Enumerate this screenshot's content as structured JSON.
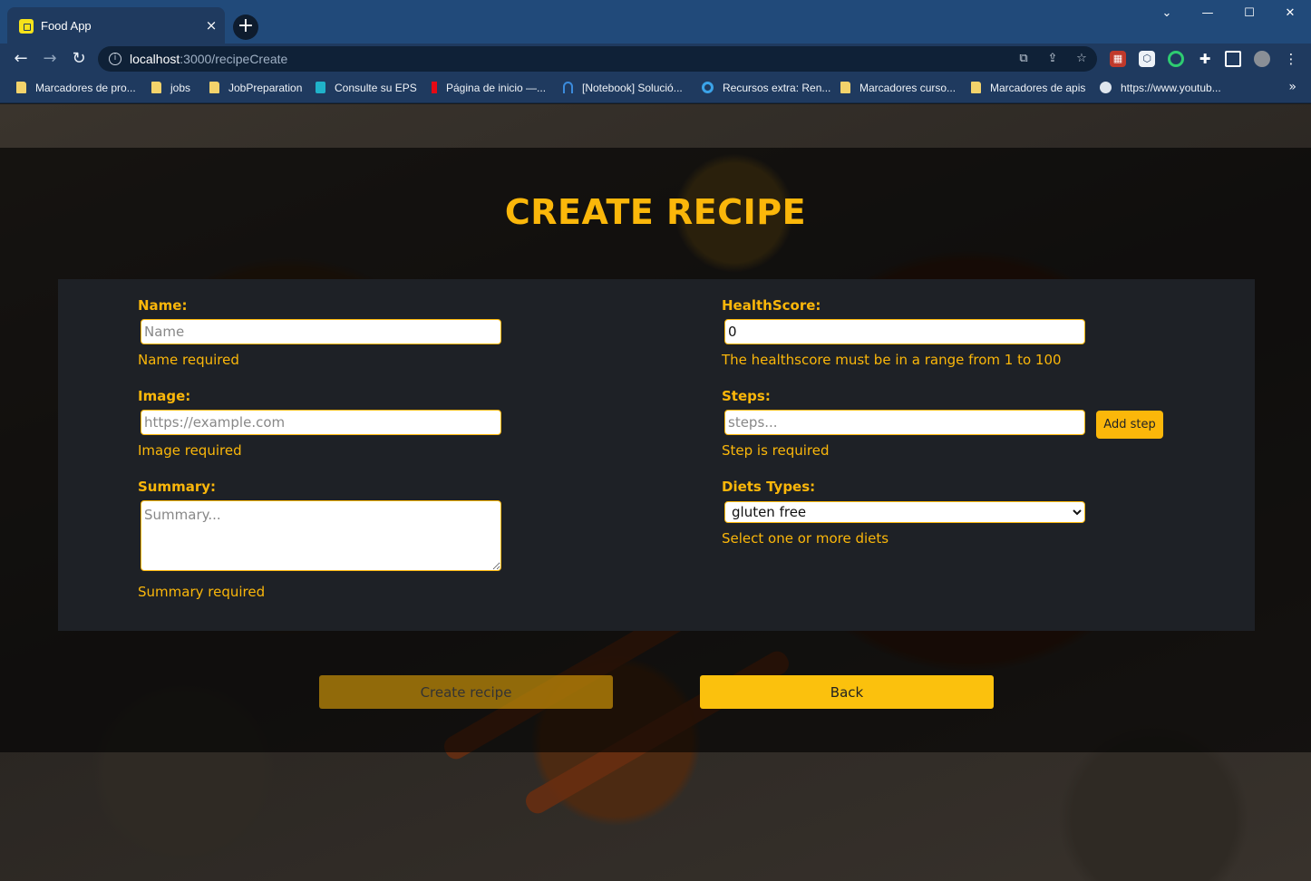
{
  "browser": {
    "tab_title": "Food App",
    "tab_close": "×",
    "new_tab": "+",
    "window_controls": [
      "⌄",
      "—",
      "☐",
      "✕"
    ],
    "url_host": "localhost",
    "url_path": ":3000/recipeCreate",
    "bookmarks": [
      "Marcadores de pro...",
      "jobs",
      "JobPreparation",
      "Consulte su EPS",
      "Página de inicio —...",
      "[Notebook] Solució...",
      "Recursos extra: Ren...",
      "Marcadores curso...",
      "Marcadores de apis",
      "https://www.youtub..."
    ],
    "bookmarks_more": "»"
  },
  "page": {
    "title": "CREATE RECIPE",
    "name": {
      "label": "Name:",
      "placeholder": "Name",
      "error": "Name required"
    },
    "image": {
      "label": "Image:",
      "placeholder": "https://example.com",
      "error": "Image required"
    },
    "summary": {
      "label": "Summary:",
      "placeholder": "Summary...",
      "error": "Summary required"
    },
    "healthscore": {
      "label": "HealthScore:",
      "value": "0",
      "error": "The healthscore must be in a range from 1 to 100"
    },
    "steps": {
      "label": "Steps:",
      "placeholder": "steps...",
      "add_label": "Add step",
      "error": "Step is required"
    },
    "diets": {
      "label": "Diets Types:",
      "selected": "gluten free",
      "hint": "Select one or more diets"
    },
    "create_label": "Create recipe",
    "back_label": "Back"
  },
  "colors": {
    "accent": "#fbb70a",
    "panel": "#1e2126",
    "chrome": "#214a7a"
  }
}
